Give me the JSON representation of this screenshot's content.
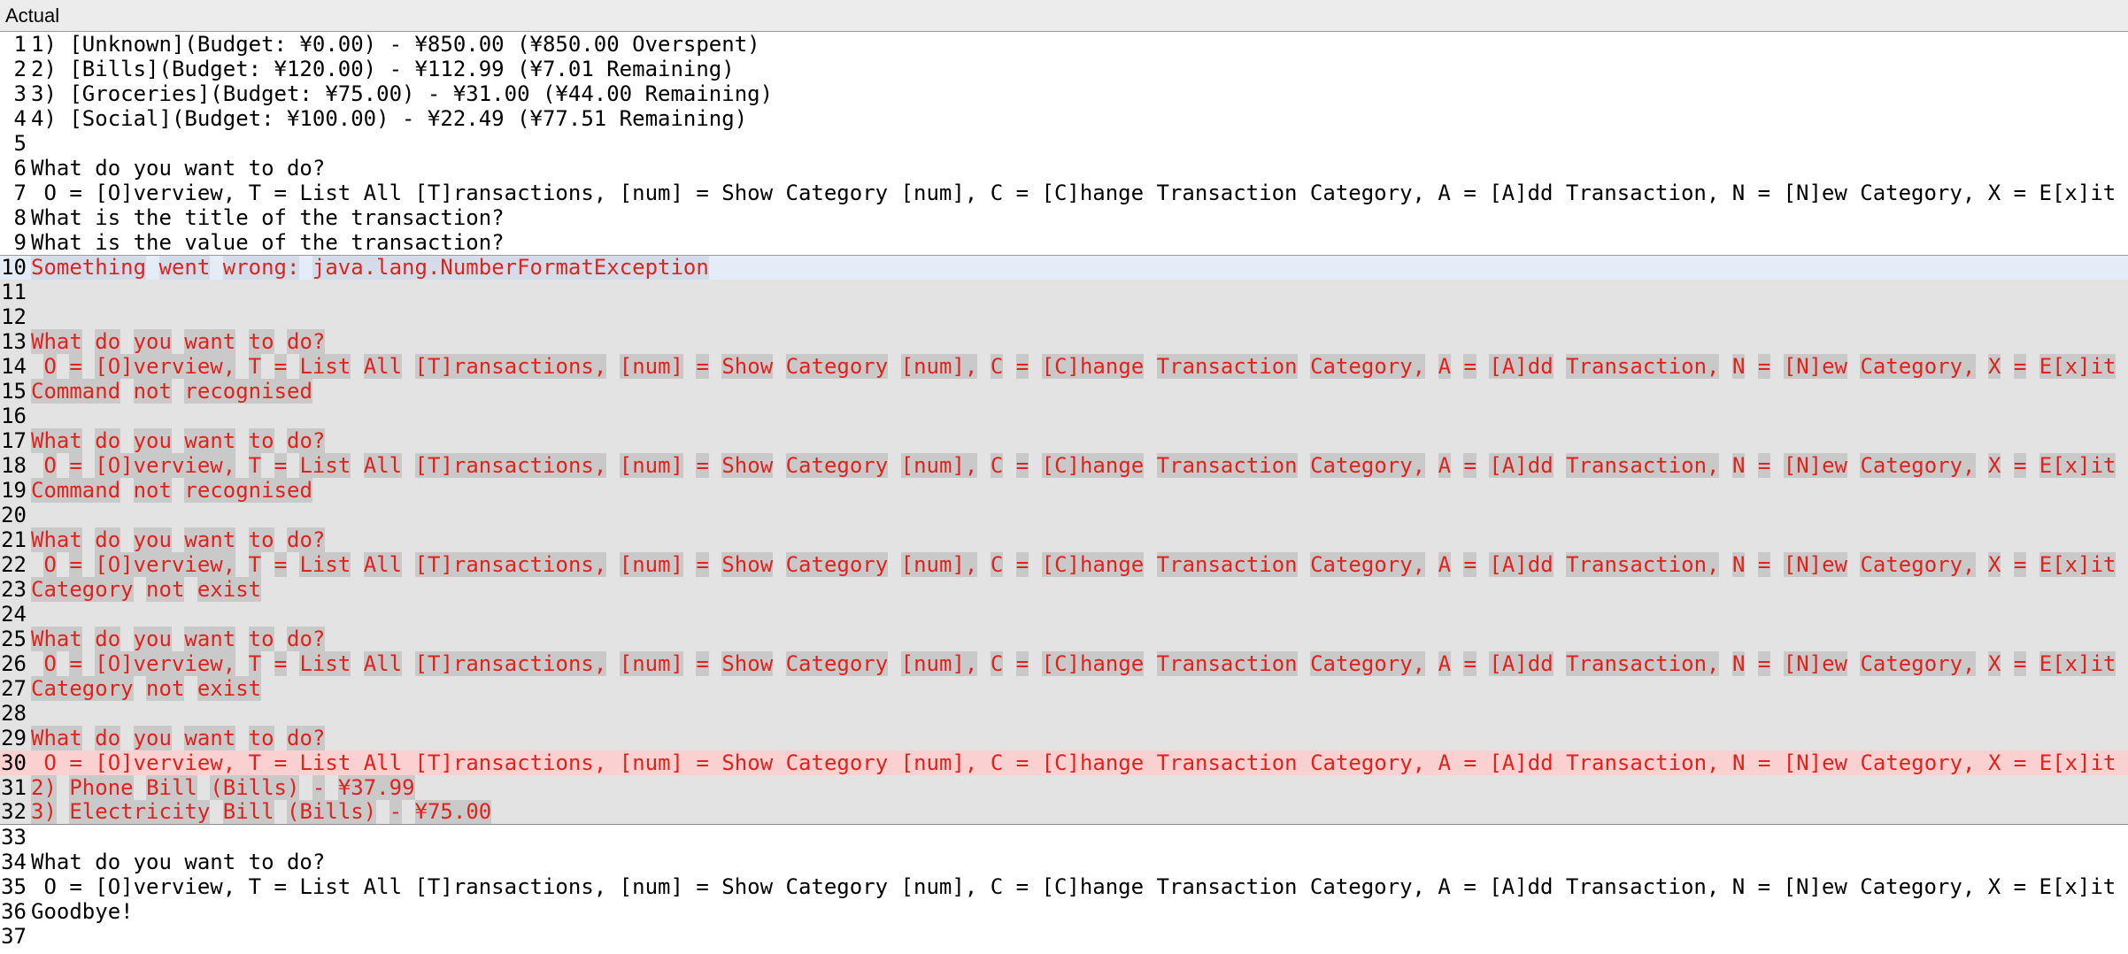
{
  "panel": {
    "title": "Actual"
  },
  "lines": [
    {
      "n": "1",
      "t": "1) [Unknown](Budget: ¥0.00) - ¥850.00 (¥850.00 Overspent)",
      "s": "normal"
    },
    {
      "n": "2",
      "t": "2) [Bills](Budget: ¥120.00) - ¥112.99 (¥7.01 Remaining)",
      "s": "normal"
    },
    {
      "n": "3",
      "t": "3) [Groceries](Budget: ¥75.00) - ¥31.00 (¥44.00 Remaining)",
      "s": "normal"
    },
    {
      "n": "4",
      "t": "4) [Social](Budget: ¥100.00) - ¥22.49 (¥77.51 Remaining)",
      "s": "normal"
    },
    {
      "n": "5",
      "t": "",
      "s": "normal"
    },
    {
      "n": "6",
      "t": "What do you want to do?",
      "s": "normal"
    },
    {
      "n": "7",
      "t": " O = [O]verview, T = List All [T]ransactions, [num] = Show Category [num], C = [C]hange Transaction Category, A = [A]dd Transaction, N = [N]ew Category, X = E[x]it",
      "s": "normal"
    },
    {
      "n": "8",
      "t": "What is the title of the transaction?",
      "s": "normal"
    },
    {
      "n": "9",
      "t": "What is the value of the transaction?",
      "s": "normal"
    },
    {
      "n": "10",
      "t": "Something went wrong: java.lang.NumberFormatException",
      "s": "sel"
    },
    {
      "n": "11",
      "t": "",
      "s": "diff"
    },
    {
      "n": "12",
      "t": "",
      "s": "diff"
    },
    {
      "n": "13",
      "t": "What do you want to do?",
      "s": "diff"
    },
    {
      "n": "14",
      "t": " O = [O]verview, T = List All [T]ransactions, [num] = Show Category [num], C = [C]hange Transaction Category, A = [A]dd Transaction, N = [N]ew Category, X = E[x]it",
      "s": "diff"
    },
    {
      "n": "15",
      "t": "Command not recognised",
      "s": "diff"
    },
    {
      "n": "16",
      "t": "",
      "s": "diff"
    },
    {
      "n": "17",
      "t": "What do you want to do?",
      "s": "diff"
    },
    {
      "n": "18",
      "t": " O = [O]verview, T = List All [T]ransactions, [num] = Show Category [num], C = [C]hange Transaction Category, A = [A]dd Transaction, N = [N]ew Category, X = E[x]it",
      "s": "diff"
    },
    {
      "n": "19",
      "t": "Command not recognised",
      "s": "diff"
    },
    {
      "n": "20",
      "t": "",
      "s": "diff"
    },
    {
      "n": "21",
      "t": "What do you want to do?",
      "s": "diff"
    },
    {
      "n": "22",
      "t": " O = [O]verview, T = List All [T]ransactions, [num] = Show Category [num], C = [C]hange Transaction Category, A = [A]dd Transaction, N = [N]ew Category, X = E[x]it",
      "s": "diff"
    },
    {
      "n": "23",
      "t": "Category not exist",
      "s": "diff"
    },
    {
      "n": "24",
      "t": "",
      "s": "diff"
    },
    {
      "n": "25",
      "t": "What do you want to do?",
      "s": "diff"
    },
    {
      "n": "26",
      "t": " O = [O]verview, T = List All [T]ransactions, [num] = Show Category [num], C = [C]hange Transaction Category, A = [A]dd Transaction, N = [N]ew Category, X = E[x]it",
      "s": "diff"
    },
    {
      "n": "27",
      "t": "Category not exist",
      "s": "diff"
    },
    {
      "n": "28",
      "t": "",
      "s": "diff"
    },
    {
      "n": "29",
      "t": "What do you want to do?",
      "s": "diff"
    },
    {
      "n": "30",
      "t": " O = [O]verview, T = List All [T]ransactions, [num] = Show Category [num], C = [C]hange Transaction Category, A = [A]dd Transaction, N = [N]ew Category, X = E[x]it",
      "s": "hi"
    },
    {
      "n": "31",
      "t": "2) Phone Bill (Bills) - ¥37.99",
      "s": "diff"
    },
    {
      "n": "32",
      "t": "3) Electricity Bill (Bills) - ¥75.00",
      "s": "diff"
    },
    {
      "n": "33",
      "t": "",
      "s": "normal"
    },
    {
      "n": "34",
      "t": "What do you want to do?",
      "s": "normal"
    },
    {
      "n": "35",
      "t": " O = [O]verview, T = List All [T]ransactions, [num] = Show Category [num], C = [C]hange Transaction Category, A = [A]dd Transaction, N = [N]ew Category, X = E[x]it",
      "s": "normal"
    },
    {
      "n": "36",
      "t": "Goodbye!",
      "s": "normal"
    },
    {
      "n": "37",
      "t": "",
      "s": "normal"
    }
  ],
  "colors": {
    "diff_text": "#e0221c",
    "diff_background": "#e3e3e3",
    "selected_line_background": "#e4ecf8",
    "highlight_line_background": "#fbd0d0"
  }
}
